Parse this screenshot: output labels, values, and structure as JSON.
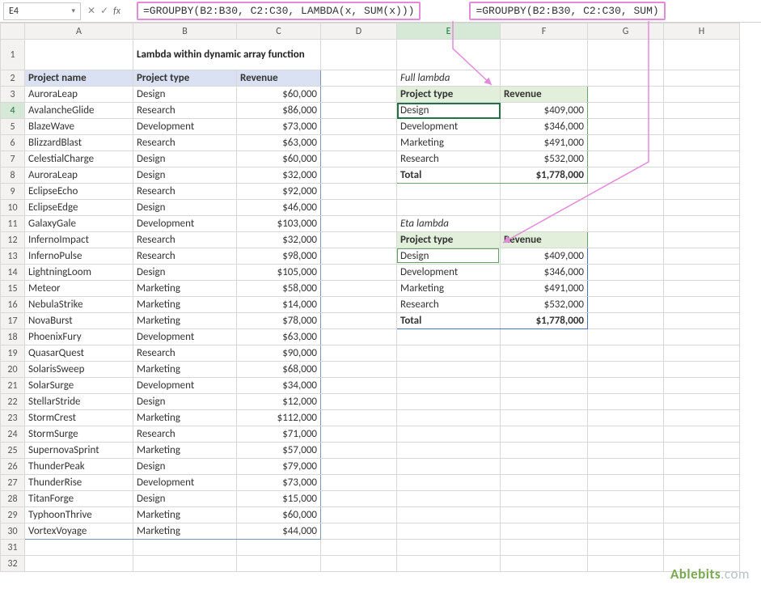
{
  "formula_bar": {
    "cell_ref": "E4",
    "formula1": "=GROUPBY(B2:B30, C2:C30, LAMBDA(x, SUM(x)))",
    "formula2": "=GROUPBY(B2:B30, C2:C30, SUM)"
  },
  "title": "Lambda within dynamic array function",
  "columns": [
    "A",
    "B",
    "C",
    "D",
    "E",
    "F",
    "G",
    "H"
  ],
  "main_table": {
    "headers": [
      "Project name",
      "Project type",
      "Revenue"
    ],
    "rows": [
      [
        "AuroraLeap",
        "Design",
        "$60,000"
      ],
      [
        "AvalancheGlide",
        "Research",
        "$86,000"
      ],
      [
        "BlazeWave",
        "Development",
        "$73,000"
      ],
      [
        "BlizzardBlast",
        "Research",
        "$63,000"
      ],
      [
        "CelestialCharge",
        "Design",
        "$60,000"
      ],
      [
        "AuroraLeap",
        "Design",
        "$32,000"
      ],
      [
        "EclipseEcho",
        "Research",
        "$92,000"
      ],
      [
        "EclipseEdge",
        "Design",
        "$46,000"
      ],
      [
        "GalaxyGale",
        "Development",
        "$103,000"
      ],
      [
        "InfernoImpact",
        "Research",
        "$32,000"
      ],
      [
        "InfernoPulse",
        "Research",
        "$98,000"
      ],
      [
        "LightningLoom",
        "Design",
        "$105,000"
      ],
      [
        "Meteor",
        "Marketing",
        "$58,000"
      ],
      [
        "NebulaStrike",
        "Marketing",
        "$14,000"
      ],
      [
        "NovaBurst",
        "Marketing",
        "$78,000"
      ],
      [
        "PhoenixFury",
        "Development",
        "$63,000"
      ],
      [
        "QuasarQuest",
        "Research",
        "$90,000"
      ],
      [
        "SolarisSweep",
        "Marketing",
        "$68,000"
      ],
      [
        "SolarSurge",
        "Development",
        "$34,000"
      ],
      [
        "StellarStride",
        "Design",
        "$12,000"
      ],
      [
        "StormCrest",
        "Marketing",
        "$112,000"
      ],
      [
        "StormSurge",
        "Research",
        "$71,000"
      ],
      [
        "SupernovaSprint",
        "Marketing",
        "$57,000"
      ],
      [
        "ThunderPeak",
        "Design",
        "$79,000"
      ],
      [
        "ThunderRise",
        "Development",
        "$73,000"
      ],
      [
        "TitanForge",
        "Design",
        "$15,000"
      ],
      [
        "TyphoonThrive",
        "Marketing",
        "$60,000"
      ],
      [
        "VortexVoyage",
        "Marketing",
        "$44,000"
      ]
    ]
  },
  "group1": {
    "caption": "Full lambda",
    "headers": [
      "Project type",
      "Revenue"
    ],
    "rows": [
      [
        "Design",
        "$409,000"
      ],
      [
        "Development",
        "$346,000"
      ],
      [
        "Marketing",
        "$491,000"
      ],
      [
        "Research",
        "$532,000"
      ]
    ],
    "total": [
      "Total",
      "$1,778,000"
    ]
  },
  "group2": {
    "caption": "Eta lambda",
    "headers": [
      "Project type",
      "Revenue"
    ],
    "rows": [
      [
        "Design",
        "$409,000"
      ],
      [
        "Development",
        "$346,000"
      ],
      [
        "Marketing",
        "$491,000"
      ],
      [
        "Research",
        "$532,000"
      ]
    ],
    "total": [
      "Total",
      "$1,778,000"
    ]
  },
  "brand": "Ablebits",
  "brand_suffix": ".com"
}
